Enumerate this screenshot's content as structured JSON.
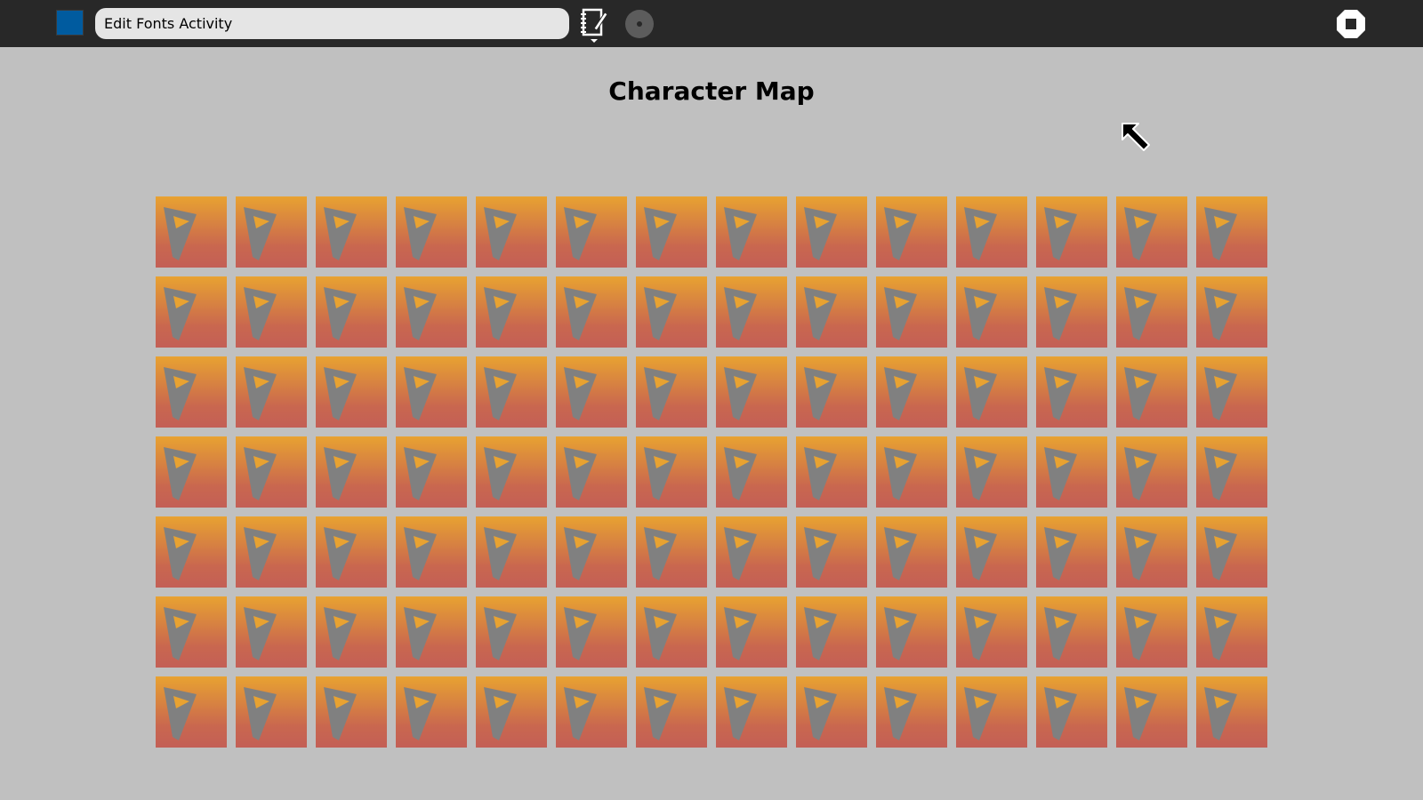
{
  "toolbar": {
    "activity_title": "Edit Fonts Activity",
    "activity_icon": "square-icon",
    "journal_icon": "journal-icon",
    "share_icon": "share-icon",
    "stop_icon": "stop-icon"
  },
  "main": {
    "title": "Character Map",
    "grid": {
      "rows": 7,
      "columns": 14,
      "cell_icon": "missing-glyph-icon"
    }
  },
  "colors": {
    "toolbar_bg": "#282828",
    "page_bg": "#c0c0c0",
    "activity_icon": "#005b9f",
    "cell_top": "#e8a231",
    "cell_bottom": "#c35f56",
    "glyph": "#808080"
  }
}
